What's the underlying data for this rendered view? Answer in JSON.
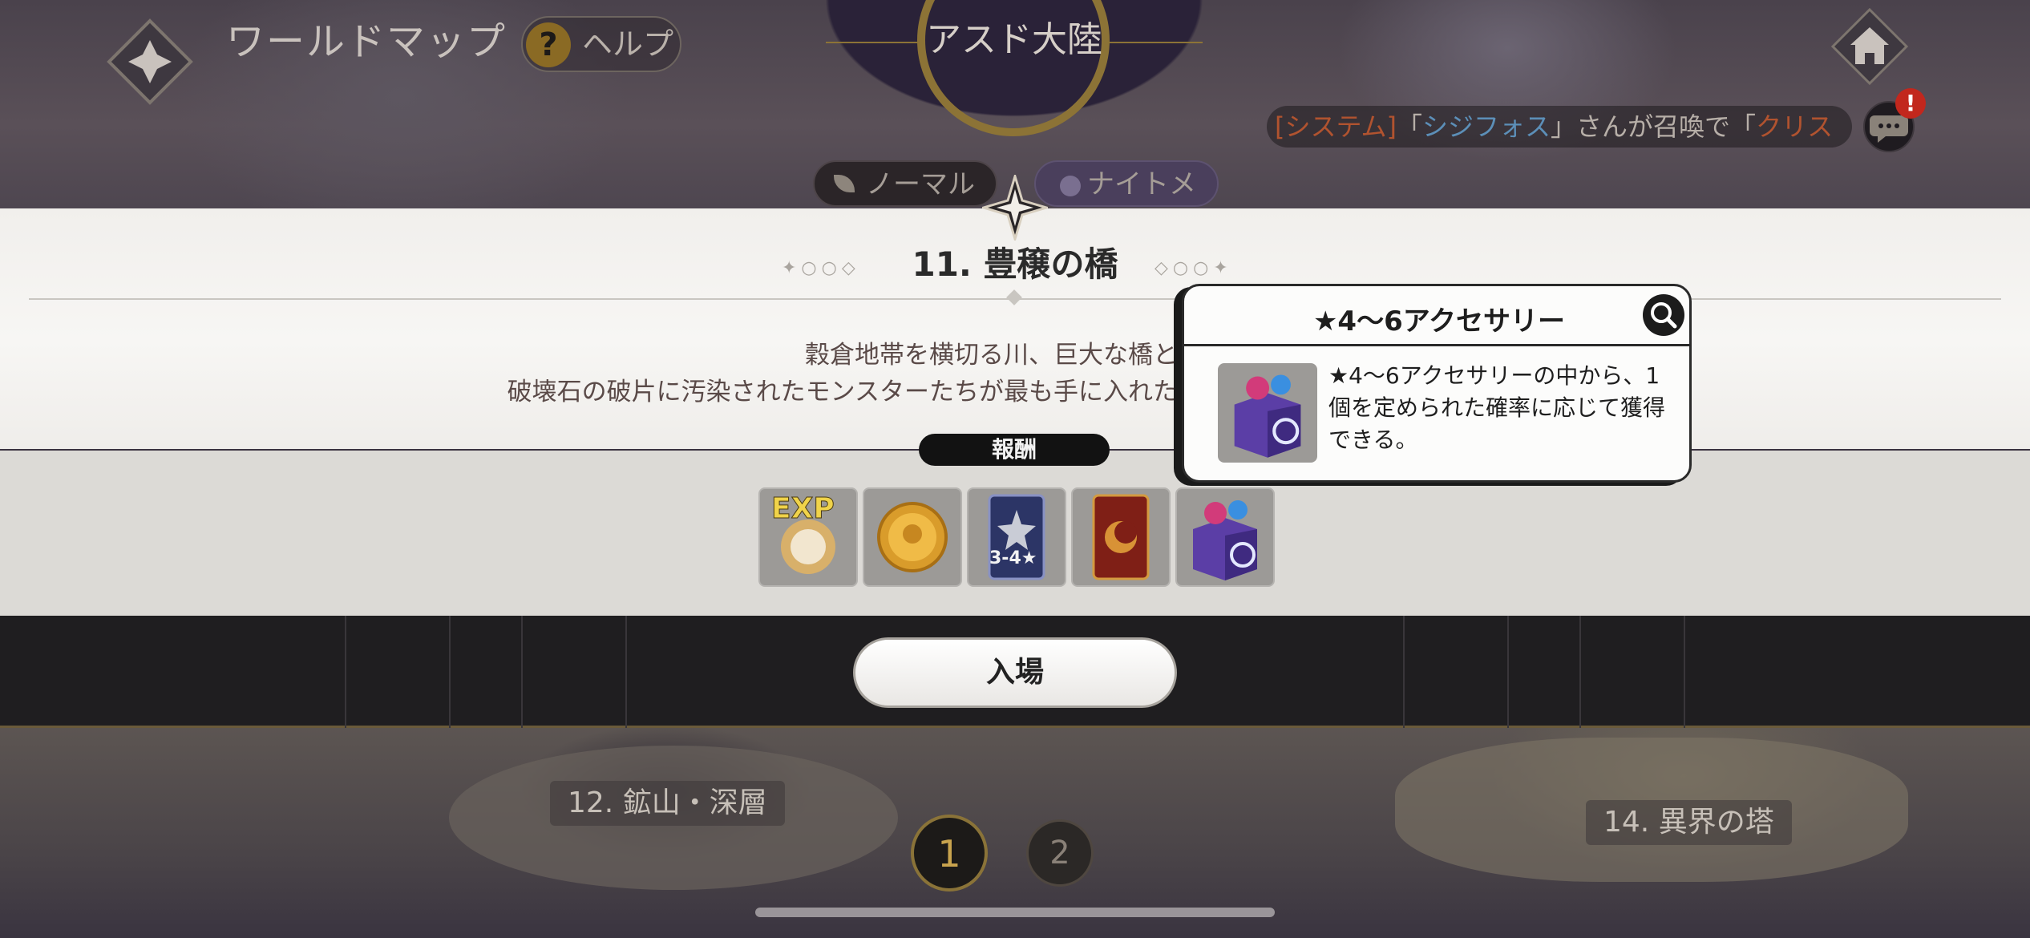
{
  "header": {
    "title": "ワールドマップ",
    "help_label": "ヘルプ",
    "help_icon_glyph": "?",
    "region_name": "アスド大陸"
  },
  "system_message": {
    "tag": "[システム]",
    "open_quote": "「",
    "player_name": "シジフォス",
    "middle": "」さんが召喚で「",
    "hero_name": "クリス"
  },
  "chat": {
    "badge": "!"
  },
  "difficulty_tabs": [
    {
      "label": "ノーマル"
    },
    {
      "label": "ナイトメア"
    }
  ],
  "stage": {
    "title": "11. 豊穣の橋",
    "description_line1": "穀倉地帯を横切る川、巨大な橋とホ",
    "description_line2": "破壊石の破片に汚染されたモンスターたちが最も手に入れたが",
    "reward_label": "報酬",
    "rewards": [
      {
        "name": "exp-reward",
        "text": "EXP"
      },
      {
        "name": "gold-reward",
        "text": ""
      },
      {
        "name": "card-reward",
        "text": "3-4★"
      },
      {
        "name": "red-card-reward",
        "text": ""
      },
      {
        "name": "accessory-box-reward",
        "text": ""
      }
    ],
    "enter_label": "入場"
  },
  "tooltip": {
    "title": "★4〜6アクセサリー",
    "text": "★4〜6アクセサリーの中から、1個を定められた確率に応じて獲得できる。"
  },
  "map": {
    "node_left_label": "12. 鉱山・深層",
    "node_right_label": "14. 異界の塔",
    "pages": [
      "1",
      "2"
    ],
    "active_page": "1"
  },
  "colors": {
    "accent_gold": "#8a7338",
    "panel_light": "#f7f6f4",
    "panel_dark": "#1f1e20",
    "system_tag": "#b1532f",
    "player_name": "#5c8fb8"
  }
}
